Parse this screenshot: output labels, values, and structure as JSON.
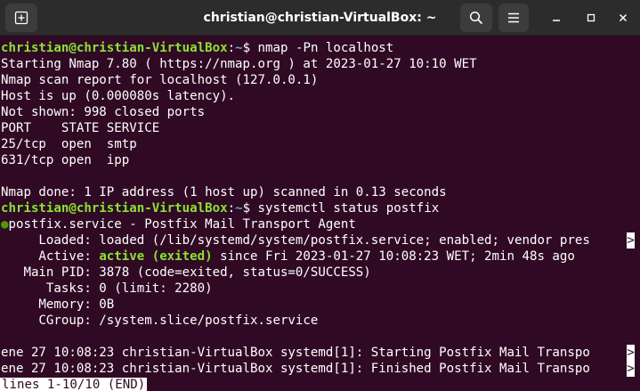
{
  "window": {
    "title": "christian@christian-VirtualBox: ~"
  },
  "icons": {
    "new_tab": "new-tab-icon",
    "search": "search-icon",
    "menu": "hamburger-menu-icon",
    "minimize": "minimize-icon",
    "maximize": "maximize-icon",
    "close": "close-icon"
  },
  "colors": {
    "background": "#300a24",
    "prompt_user": "#8ae234",
    "prompt_path": "#729fcf",
    "active_status": "#4e9a06"
  },
  "terminal": {
    "prompt_user": "christian@christian-VirtualBox",
    "prompt_sep": ":",
    "prompt_path": "~",
    "prompt_end": "$ ",
    "cmd1": "nmap -Pn localhost",
    "nmap_out": [
      "Starting Nmap 7.80 ( https://nmap.org ) at 2023-01-27 10:10 WET",
      "Nmap scan report for localhost (127.0.0.1)",
      "Host is up (0.000080s latency).",
      "Not shown: 998 closed ports",
      "PORT    STATE SERVICE",
      "25/tcp  open  smtp",
      "631/tcp open  ipp",
      "",
      "Nmap done: 1 IP address (1 host up) scanned in 0.13 seconds"
    ],
    "cmd2": "systemctl status postfix",
    "status_dot": "●",
    "service_line": "postfix.service - Postfix Mail Transport Agent",
    "loaded": "     Loaded: loaded (/lib/systemd/system/postfix.service; enabled; vendor pres",
    "active_label": "     Active: ",
    "active_state": "active (exited)",
    "active_rest": " since Fri 2023-01-27 10:08:23 WET; 2min 48s ago",
    "main_pid": "   Main PID: 3878 (code=exited, status=0/SUCCESS)",
    "tasks": "      Tasks: 0 (limit: 2280)",
    "memory": "     Memory: 0B",
    "cgroup": "     CGroup: /system.slice/postfix.service",
    "blank": "",
    "log1": "ene 27 10:08:23 christian-VirtualBox systemd[1]: Starting Postfix Mail Transpo",
    "log2": "ene 27 10:08:23 christian-VirtualBox systemd[1]: Finished Postfix Mail Transpo",
    "truncation_marker": ">",
    "pager_status": "lines 1-10/10 (END)"
  }
}
